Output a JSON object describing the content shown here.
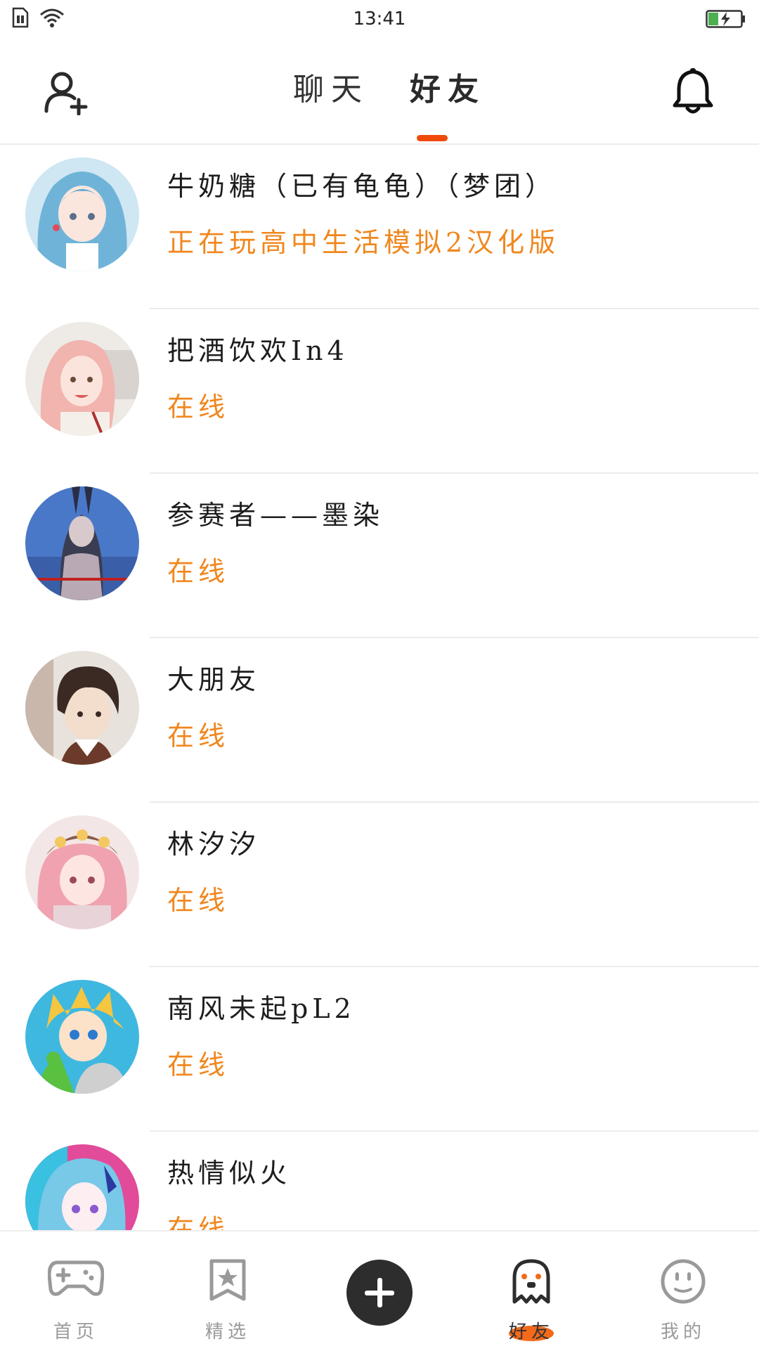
{
  "status_bar": {
    "time": "13:41",
    "icons": [
      "sim-card-icon",
      "wifi-icon",
      "battery-charging-icon"
    ]
  },
  "header": {
    "left_icon": "add-friend-icon",
    "right_icon": "bell-icon",
    "tabs": [
      {
        "label": "聊天",
        "active": false
      },
      {
        "label": "好友",
        "active": true
      }
    ],
    "accent_color": "#f04a0a"
  },
  "friends": [
    {
      "name": "牛奶糖（已有龟龟）（梦团）",
      "status": "正在玩高中生活模拟2汉化版",
      "avatar": "avatar-blue-hair-girl"
    },
    {
      "name": "把酒饮欢In4",
      "status": "在线",
      "avatar": "avatar-pink-hair-girl"
    },
    {
      "name": "参赛者——墨染",
      "status": "在线",
      "avatar": "avatar-bunny-ears-girl"
    },
    {
      "name": "大朋友",
      "status": "在线",
      "avatar": "avatar-dark-hair-boy"
    },
    {
      "name": "林汐汐",
      "status": "在线",
      "avatar": "avatar-pink-hair-hat-girl"
    },
    {
      "name": "南风未起pL2",
      "status": "在线",
      "avatar": "avatar-blonde-boy"
    },
    {
      "name": "热情似火",
      "status": "在线",
      "avatar": "avatar-blue-hair-purple-eyes"
    }
  ],
  "bottom_nav": {
    "items": [
      {
        "label": "首页",
        "icon": "gamepad-icon",
        "active": false
      },
      {
        "label": "精选",
        "icon": "star-bookmark-icon",
        "active": false
      },
      {
        "label": "",
        "icon": "plus-icon",
        "active": false
      },
      {
        "label": "好友",
        "icon": "ghost-icon",
        "active": true
      },
      {
        "label": "我的",
        "icon": "smiley-face-icon",
        "active": false
      }
    ]
  },
  "colors": {
    "status_text": "#f0871e",
    "inactive_nav": "#9a9a9a",
    "active_blob": "#f36a1a"
  }
}
